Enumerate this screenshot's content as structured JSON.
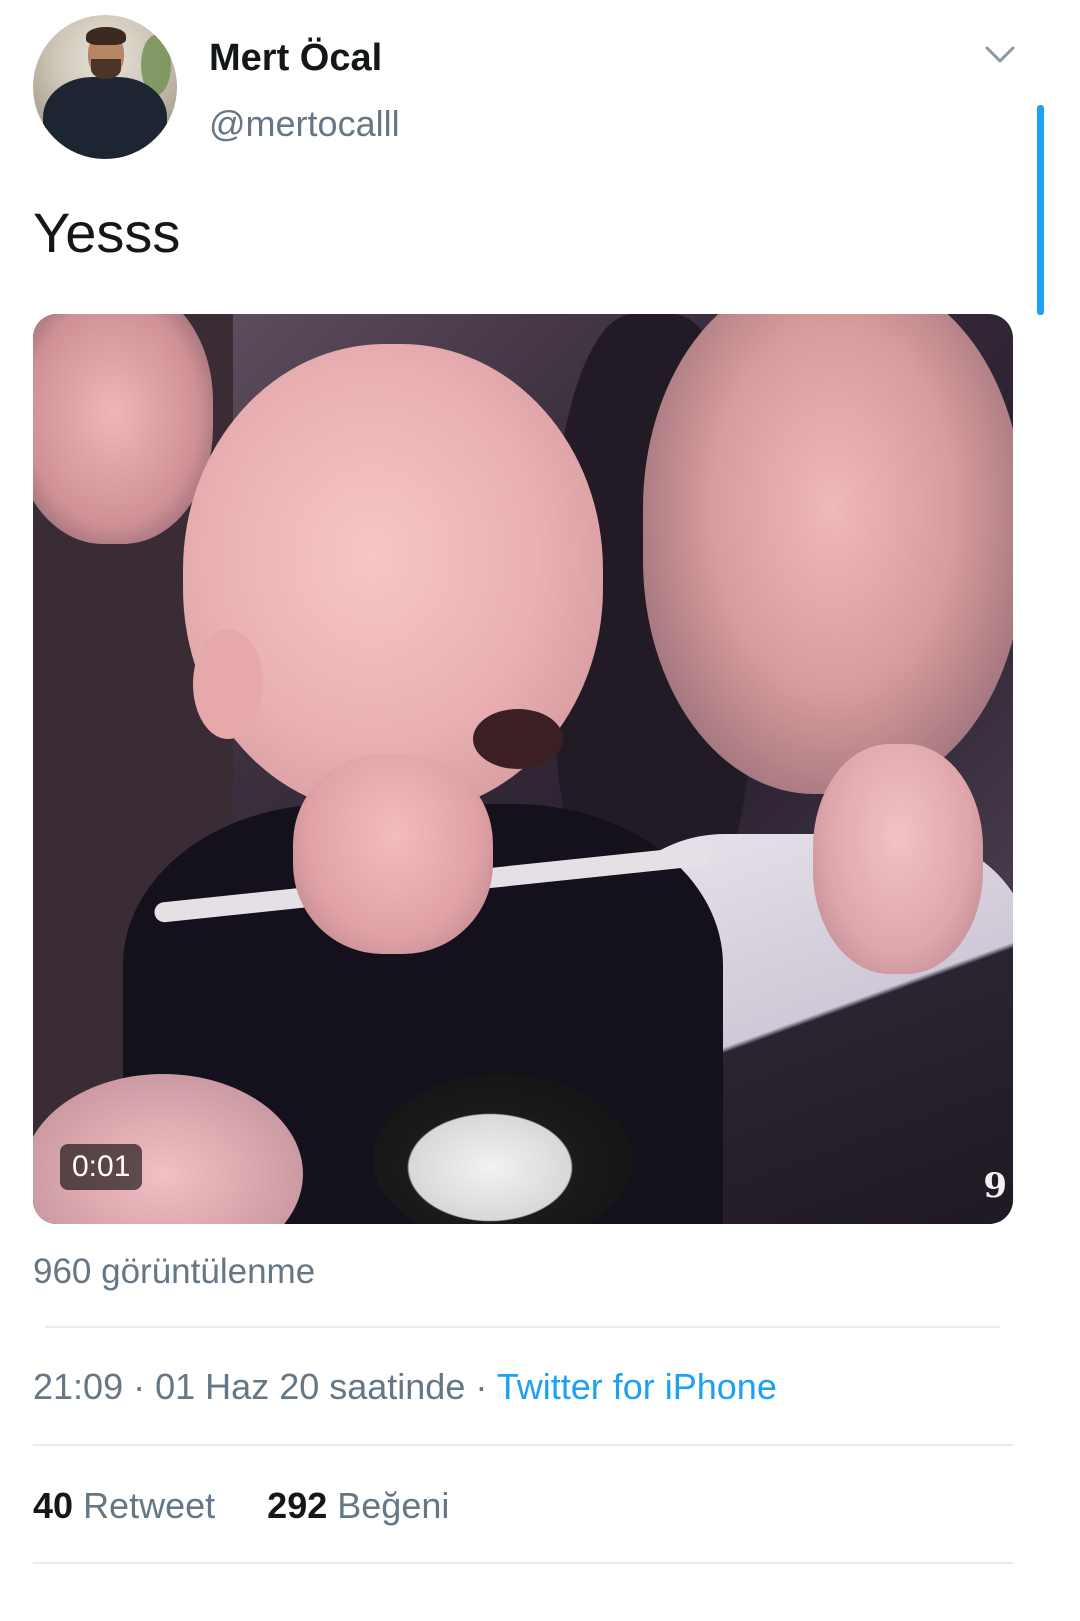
{
  "tweet": {
    "author_name": "Mert Öcal",
    "author_handle": "@mertocalll",
    "text": "Yesss",
    "media": {
      "duration": "0:01"
    },
    "views_label": "960 görüntülenme",
    "time": "21:09",
    "date_text": "01 Haz 20 saatinde",
    "separator": "·",
    "source": "Twitter for iPhone",
    "retweets": {
      "count": "40",
      "label": "Retweet"
    },
    "likes": {
      "count": "292",
      "label": "Beğeni"
    }
  },
  "icons": {
    "menu": "chevron-down-icon"
  },
  "colors": {
    "accent": "#1da1f2",
    "secondary_text": "#657786",
    "primary_text": "#14171a",
    "divider": "#e6ecf0"
  }
}
